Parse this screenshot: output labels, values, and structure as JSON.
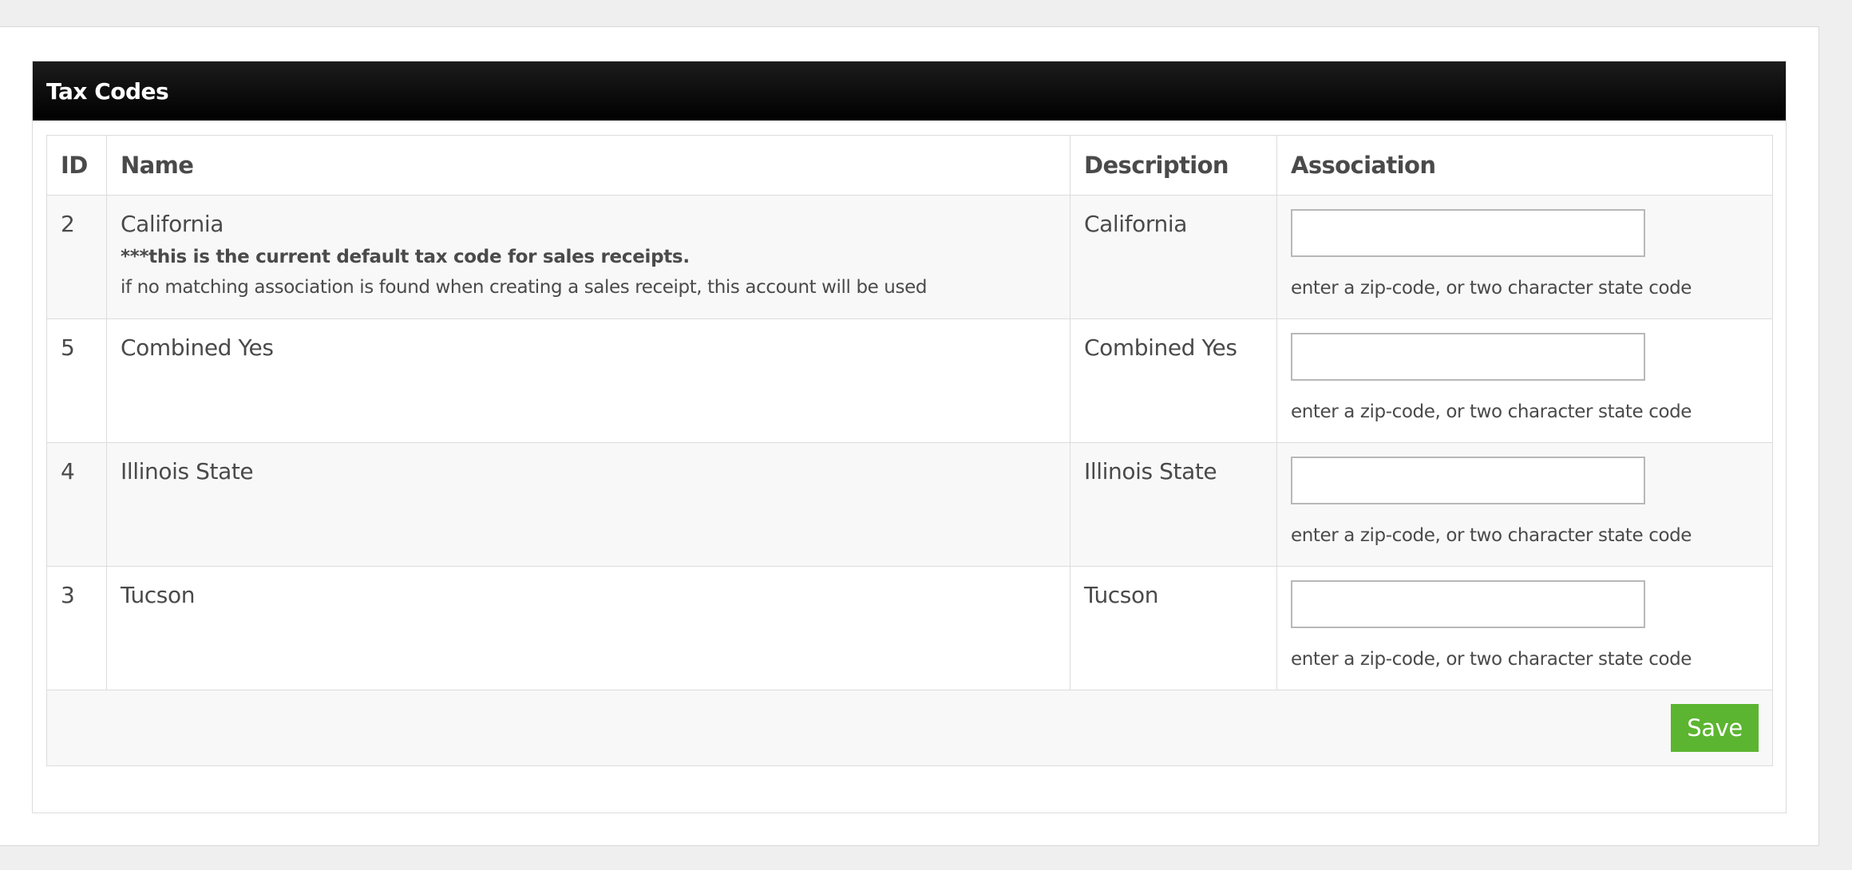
{
  "panel": {
    "title": "Tax Codes"
  },
  "table": {
    "columns": {
      "id": "ID",
      "name": "Name",
      "description": "Description",
      "association": "Association"
    },
    "rows": [
      {
        "id": "2",
        "name": "California",
        "note": "***this is the current default tax code for sales receipts.",
        "subnote": "if no matching association is found when creating a sales receipt, this account will be used",
        "description": "California",
        "association_value": "",
        "association_help": "enter a zip-code, or two character state code"
      },
      {
        "id": "5",
        "name": "Combined Yes",
        "description": "Combined Yes",
        "association_value": "",
        "association_help": "enter a zip-code, or two character state code"
      },
      {
        "id": "4",
        "name": "Illinois State",
        "description": "Illinois State",
        "association_value": "",
        "association_help": "enter a zip-code, or two character state code"
      },
      {
        "id": "3",
        "name": "Tucson",
        "description": "Tucson",
        "association_value": "",
        "association_help": "enter a zip-code, or two character state code"
      }
    ]
  },
  "actions": {
    "save_label": "Save"
  },
  "colors": {
    "header_bg": "#000000",
    "save_button": "#5cb531",
    "row_alt": "#f8f8f8"
  }
}
